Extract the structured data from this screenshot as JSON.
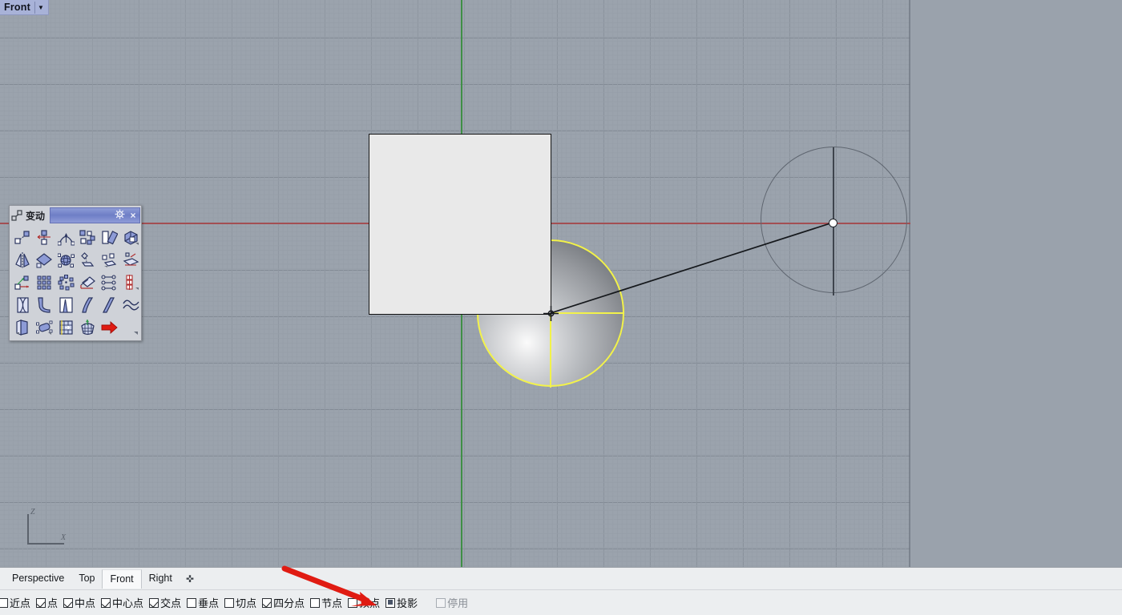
{
  "viewport": {
    "title": "Front",
    "caret": "▼",
    "axis_gizmo": {
      "z_label": "Z",
      "x_label": "X"
    },
    "colors": {
      "background": "#9aa2ac",
      "grid_minor": "#969ea8",
      "grid_major": "#7a828d",
      "axis_x": "#a34f53",
      "axis_y": "#3f8f46",
      "selection": "#f2f24a",
      "surface_fill": "#e9e9e9",
      "surface_edge": "#141414",
      "preview_wire": "#5f6670",
      "annotation_arrow": "#e01b12"
    },
    "objects": [
      {
        "name": "rectangle-surface",
        "type": "planar-surface",
        "state": "unselected"
      },
      {
        "name": "sphere",
        "type": "sphere",
        "state": "selected"
      },
      {
        "name": "circle-preview",
        "type": "circle",
        "state": "preview"
      },
      {
        "name": "radius-line",
        "type": "rubber-band-line",
        "state": "preview"
      },
      {
        "name": "snap-marker",
        "type": "osnap-crosshair",
        "state": "active"
      }
    ]
  },
  "toolbar": {
    "title": "变动",
    "gear_icon": "gear-icon",
    "close_icon": "×",
    "rows": 5,
    "columns": 6,
    "buttons": [
      {
        "name": "move",
        "row": 1
      },
      {
        "name": "rotate",
        "row": 1
      },
      {
        "name": "bend",
        "row": 1
      },
      {
        "name": "array",
        "row": 1
      },
      {
        "name": "rotate-3d",
        "row": 1
      },
      {
        "name": "box-edit",
        "row": 1
      },
      {
        "name": "mirror",
        "row": 2
      },
      {
        "name": "flow",
        "row": 2
      },
      {
        "name": "flow-along-surface",
        "row": 2
      },
      {
        "name": "project-to-cplane",
        "row": 2
      },
      {
        "name": "orient",
        "row": 2
      },
      {
        "name": "orient-on-surface",
        "row": 2
      },
      {
        "name": "set-points",
        "row": 3
      },
      {
        "name": "array-rectangular",
        "row": 3
      },
      {
        "name": "array-polar",
        "row": 3
      },
      {
        "name": "array-along-curve",
        "row": 3
      },
      {
        "name": "array-linear",
        "row": 3
      },
      {
        "name": "array-along-surface",
        "row": 3
      },
      {
        "name": "twist",
        "row": 4
      },
      {
        "name": "bend-curve",
        "row": 4
      },
      {
        "name": "taper",
        "row": 4
      },
      {
        "name": "shear",
        "row": 4
      },
      {
        "name": "shear-alt",
        "row": 4
      },
      {
        "name": "smooth",
        "row": 4
      },
      {
        "name": "scale-1d",
        "row": 5
      },
      {
        "name": "scale-nu",
        "row": 5
      },
      {
        "name": "cage-edit",
        "row": 5
      },
      {
        "name": "cage-box",
        "row": 5
      },
      {
        "name": "transform-arrow",
        "row": 5
      }
    ]
  },
  "viewport_tabs": {
    "items": [
      {
        "label": "Perspective",
        "active": false
      },
      {
        "label": "Top",
        "active": false
      },
      {
        "label": "Front",
        "active": true
      },
      {
        "label": "Right",
        "active": false
      }
    ],
    "add_label": "✜"
  },
  "osnap_bar": {
    "items": [
      {
        "label": "近点",
        "state": "unchecked",
        "enabled": true
      },
      {
        "label": "点",
        "state": "checked",
        "enabled": true
      },
      {
        "label": "中点",
        "state": "checked",
        "enabled": true
      },
      {
        "label": "中心点",
        "state": "checked",
        "enabled": true
      },
      {
        "label": "交点",
        "state": "checked",
        "enabled": true
      },
      {
        "label": "垂点",
        "state": "unchecked",
        "enabled": true
      },
      {
        "label": "切点",
        "state": "unchecked",
        "enabled": true
      },
      {
        "label": "四分点",
        "state": "checked",
        "enabled": true
      },
      {
        "label": "节点",
        "state": "unchecked",
        "enabled": true
      },
      {
        "label": "顶点",
        "state": "unchecked",
        "enabled": true
      },
      {
        "label": "投影",
        "state": "filled",
        "enabled": true
      },
      {
        "label": "停用",
        "state": "unchecked",
        "enabled": false
      }
    ]
  },
  "annotation": {
    "arrow": "red-arrow",
    "points_to": "投影"
  }
}
